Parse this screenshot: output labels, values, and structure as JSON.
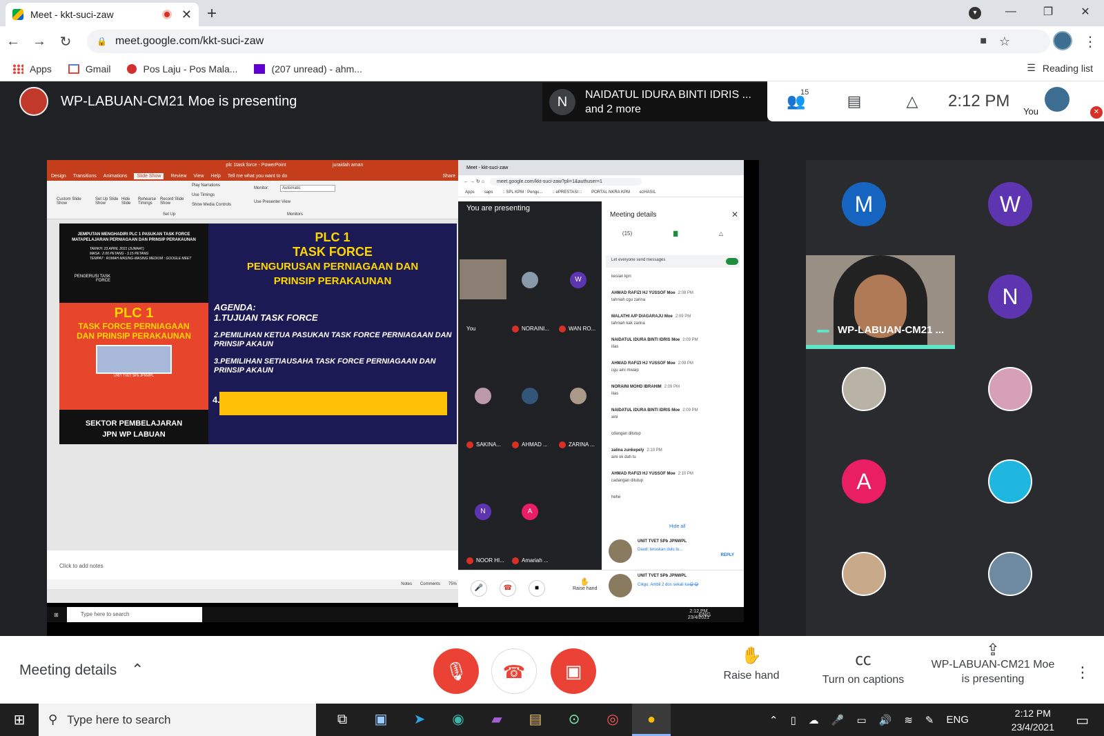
{
  "browser": {
    "tab_title": "Meet - kkt-suci-zaw",
    "url": "meet.google.com/kkt-suci-zaw",
    "bookmarks": [
      "Apps",
      "Gmail",
      "Pos Laju - Pos Mala...",
      "(207 unread) - ahm..."
    ],
    "reading_list": "Reading list"
  },
  "meet": {
    "presenting_title": "WP-LABUAN-CM21 Moe is presenting",
    "speaker_initial": "N",
    "speaker_line1": "NAIDATUL IDURA BINTI IDRIS ...",
    "speaker_line2": "and 2 more",
    "people_count": "15",
    "clock": "2:12 PM",
    "you_label": "You"
  },
  "shared": {
    "ppt_title": "plc 1task force  -  PowerPoint",
    "ppt_user": "juraidah aman",
    "ppt_tabs": [
      "Design",
      "Transitions",
      "Animations",
      "Slide Show",
      "Review",
      "View",
      "Help",
      "Tell me what you want to do"
    ],
    "ppt_share": "Share",
    "ribbon": {
      "custom": "Custom Slide Show",
      "setup": "Set Up Slide Show",
      "hide": "Hide Slide",
      "rehearse": "Rehearse Timings",
      "record": "Record Slide Show",
      "play": "Play Narrations",
      "timings": "Use Timings",
      "media": "Show Media Controls",
      "setup_grp": "Set Up",
      "monitor": "Monitor:",
      "monitor_val": "Automatic",
      "presenter": "Use Presenter View",
      "monitors_grp": "Monitors"
    },
    "slide": {
      "invite": "JEMPUTAN MENGHADIRI PLC 1 PASUKAN TASK FORCE MATAPELAJARAN PERNIAGAAN DAN PRINSIP PERAKAUNAN",
      "meta1": "TARIKH: 23 APRIL 2021 (JUMAAT)",
      "meta2": "MASA : 2.00 PETANG - 3.15 PETANG",
      "meta3": "TEMPAT : RUMAH MASING-MASING MEDIUM : GOOGLE MEET",
      "pengerusi": "PENGERUSI TASK FORCE",
      "left_big": "PLC 1",
      "left_sub": "TASK FORCE PERNIAGAAN DAN PRINSIP PERAKAUNAN",
      "left_foot1": "SEKTOR PEMBELAJARAN",
      "left_foot2": "JPN WP LABUAN",
      "unit": "UNIT TVET SPb JPNWPL",
      "title1": "PLC 1",
      "title2": "TASK FORCE",
      "title3": "PENGURUSAN PERNIAGAAN DAN",
      "title4": "PRINSIP PERAKAUNAN",
      "agenda": "AGENDA:",
      "item1": "1.TUJUAN TASK FORCE",
      "item2": "2.PEMILIHAN KETUA PASUKAN TASK FORCE PERNIAGAAN DAN PRINSIP AKAUN",
      "item3": "3.PEMILIHAN SETIAUSAHA TASK FORCE PERNIAGAAN DAN PRINSIP AKAUN",
      "item4": "4."
    },
    "notes": "Click to add notes",
    "ppt_status": [
      "Notes",
      "Comments",
      "75%"
    ],
    "inner_tab": "Meet - kkt-suci-zaw",
    "inner_url": "meet.google.com/kkt-suci-zaw?pli=1&authuser=1",
    "inner_bm": [
      "Apps",
      "saps",
      ":: SPL KPM : Pengu...",
      ":: ePRESTASI ::",
      "PORTAL NKRA KPM",
      "ezHASIL"
    ],
    "you_presenting": "You are presenting",
    "grid_labels": [
      "You",
      "NORAINI...",
      "WAN RO...",
      "SAKINA...",
      "AHMAD ...",
      "ZARINA ...",
      "NOOR HI...",
      "Amariah ..."
    ],
    "grid_initials": [
      "W",
      "N",
      "A"
    ],
    "meeting_details": "Meeting details",
    "people_tab": "(15)",
    "let_everyone": "Let everyone send messages",
    "messages": [
      {
        "who": "",
        "time": "",
        "text": "kesian kpn"
      },
      {
        "who": "AHMAD RAFIZI HJ YUSSOF Moe",
        "time": "2:08 PM",
        "text": "tahniah cgu zarina"
      },
      {
        "who": "MALATHI A/P DIAGARAJU Moe",
        "time": "2:09 PM",
        "text": "tahniah kak zarina"
      },
      {
        "who": "NAIDATUL IDURA BINTI IDRIS Moe",
        "time": "2:09 PM",
        "text": "ilias"
      },
      {
        "who": "AHMAD RAFIZI HJ YUSSOF Moe",
        "time": "2:09 PM",
        "text": "cgu aini mwaip"
      },
      {
        "who": "NORAINI MOHD IBRAHIM",
        "time": "2:09 PM",
        "text": "ilias"
      },
      {
        "who": "NAIDATUL IDURA BINTI IDRIS Moe",
        "time": "2:09 PM",
        "text": "aini"
      },
      {
        "who": "",
        "time": "",
        "text": "cdangan ditutup"
      },
      {
        "who": "zalina zunkepely",
        "time": "2:10 PM",
        "text": "aini ok dah tu"
      },
      {
        "who": "AHMAD RAFIZI HJ YUSSOF Moe",
        "time": "2:10 PM",
        "text": "cadangan ditutup"
      },
      {
        "who": "",
        "time": "",
        "text": "hehe"
      }
    ],
    "hide_all": "Hide all",
    "notif1_group": "UNIT TVET SPb JPNWPL",
    "notif1_body": "Daud: teruskan dulu tu...",
    "notif1_reply": "REPLY",
    "notif2_group": "UNIT TVET SPb JPNWPL",
    "notif2_body": "Cikgu: Ambil 2 dos sekali ka😂😂",
    "raise_hand": "Raise hand",
    "inner_search": "Type here to search",
    "inner_lang": "ENG",
    "inner_time": "2:12 PM",
    "inner_date": "23/4/2021"
  },
  "tiles": {
    "initials": [
      "M",
      "W",
      "N",
      "A"
    ],
    "video_name": "WP-LABUAN-CM21 ...",
    "colors": {
      "M": "#1565c0",
      "W": "#5e35b1",
      "N": "#5e35b1",
      "A": "#e91e63"
    }
  },
  "controls": {
    "meeting_details": "Meeting details",
    "raise_hand": "Raise hand",
    "captions": "Turn on captions",
    "presenting1": "WP-LABUAN-CM21 Moe",
    "presenting2": "is presenting"
  },
  "taskbar": {
    "search": "Type here to search",
    "lang": "ENG",
    "time": "2:12 PM",
    "date": "23/4/2021"
  }
}
